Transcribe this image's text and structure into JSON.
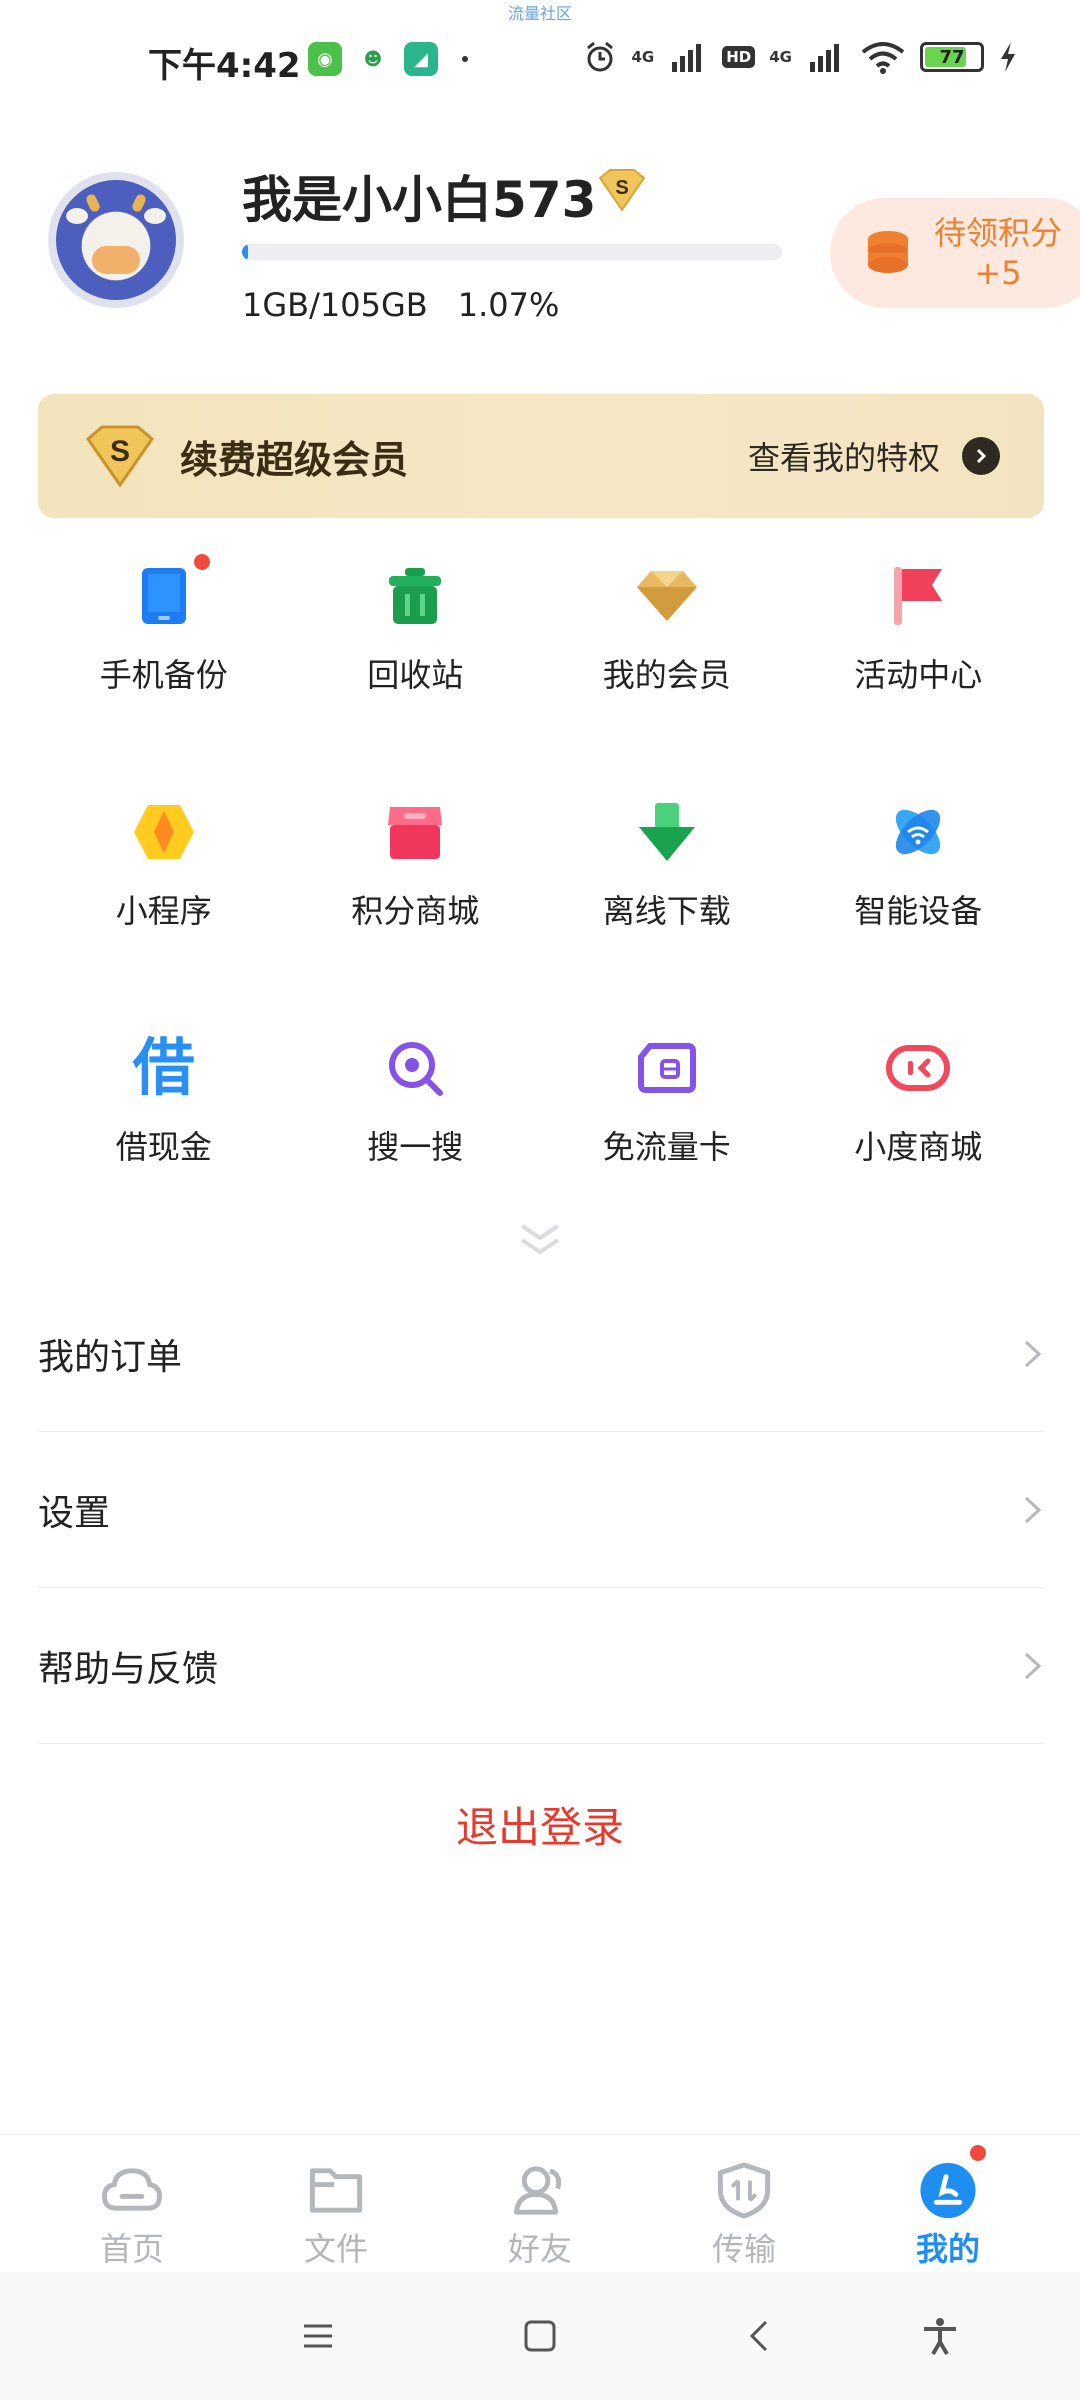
{
  "watermark": "流量社区",
  "status_bar": {
    "time": "下午4:42",
    "network_1": "4G",
    "hd": "HD",
    "network_2": "4G",
    "battery": "77",
    "battery_level": 0.77,
    "app_icons": [
      "cat-app-icon",
      "alien-app-icon",
      "plane-app-icon"
    ]
  },
  "profile": {
    "username": "我是小小白573",
    "vip_badge": "S",
    "quota_used": "1GB/105GB",
    "quota_percent": "1.07%",
    "quota_fraction": 0.0107,
    "points_label": "待领积分",
    "points_value": "+5"
  },
  "vip_banner": {
    "badge": "S",
    "title": "续费超级会员",
    "link": "查看我的特权"
  },
  "grid": [
    {
      "label": "手机备份",
      "icon": "phone-backup-icon",
      "has_dot": true
    },
    {
      "label": "回收站",
      "icon": "recycle-bin-icon"
    },
    {
      "label": "我的会员",
      "icon": "diamond-icon"
    },
    {
      "label": "活动中心",
      "icon": "flag-icon"
    },
    {
      "label": "小程序",
      "icon": "mini-program-icon"
    },
    {
      "label": "积分商城",
      "icon": "shop-icon"
    },
    {
      "label": "离线下载",
      "icon": "download-icon"
    },
    {
      "label": "智能设备",
      "icon": "smart-device-icon"
    },
    {
      "label": "借现金",
      "icon": "borrow-icon",
      "glyph": "借"
    },
    {
      "label": "搜一搜",
      "icon": "search-icon"
    },
    {
      "label": "免流量卡",
      "icon": "sim-card-icon"
    },
    {
      "label": "小度商城",
      "icon": "xiaodu-icon"
    }
  ],
  "menu": [
    {
      "label": "我的订单"
    },
    {
      "label": "设置"
    },
    {
      "label": "帮助与反馈"
    }
  ],
  "logout": "退出登录",
  "tabs": [
    {
      "label": "首页",
      "icon": "home-cloud-icon"
    },
    {
      "label": "文件",
      "icon": "folder-icon"
    },
    {
      "label": "好友",
      "icon": "friends-icon"
    },
    {
      "label": "传输",
      "icon": "transfer-icon"
    },
    {
      "label": "我的",
      "icon": "me-icon",
      "active": true
    }
  ],
  "colors": {
    "accent": "#1e8ff1",
    "logout": "#e8392c",
    "points": "#f0802f",
    "dot": "#f04a3d"
  }
}
